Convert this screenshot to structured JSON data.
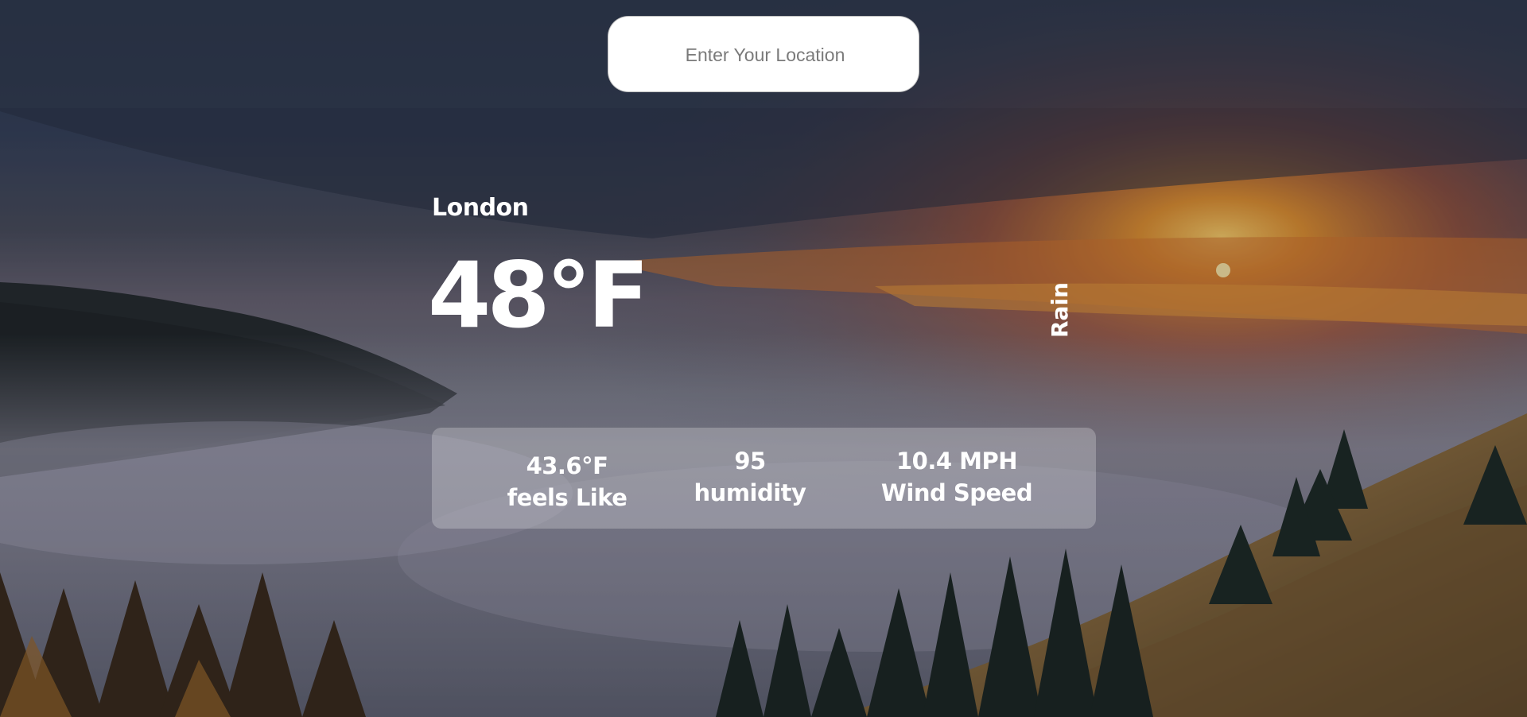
{
  "search": {
    "placeholder": "Enter Your Location",
    "value": ""
  },
  "weather": {
    "city": "London",
    "temperature": "48°F",
    "condition": "Rain"
  },
  "stats": {
    "feels_like": {
      "value": "43.6°F",
      "label": "feels Like"
    },
    "humidity": {
      "value": "95",
      "label": "humidity"
    },
    "wind": {
      "value": "10.4 MPH",
      "label": "Wind Speed"
    }
  },
  "background": {
    "scene": "foggy-forest-sunset-photo"
  },
  "colors": {
    "text": "#ffffff",
    "panel": "rgba(255,255,255,0.24)",
    "sun": "#f2a33a"
  }
}
